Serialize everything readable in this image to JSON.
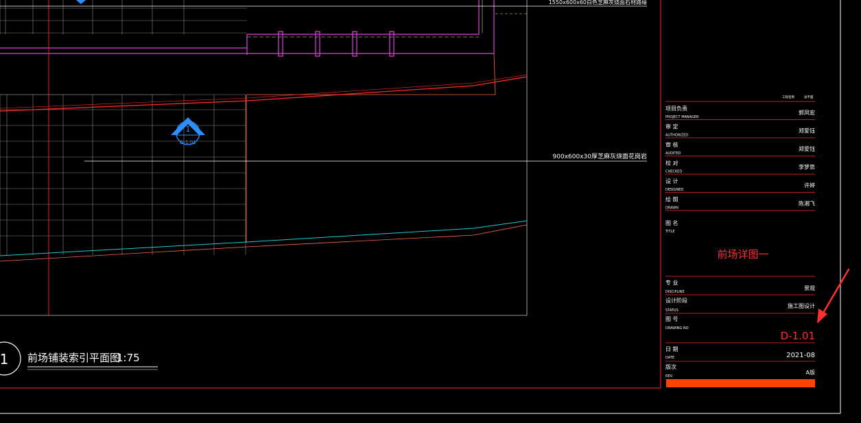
{
  "plan": {
    "top_note": "1550x600x60白色芝麻灰烧面石材路缘",
    "paving_note": "900x600x30厚芝麻灰烧面花岗岩",
    "index_symbol": {
      "number": "1",
      "sheet": "D-1.01"
    },
    "title_number": "1",
    "title_name": "前场铺装索引平面图",
    "scale": "1:75"
  },
  "title_block": {
    "header_left": "工程名称",
    "header_right": "总平面",
    "rows": [
      {
        "cn": "项目负责",
        "en": "PROJECT MANAGER",
        "value": "郭凤宏"
      },
      {
        "cn": "审 定",
        "en": "AUTHORIZED",
        "value": "郑爱钰"
      },
      {
        "cn": "审 核",
        "en": "AUDITED",
        "value": "郑爱钰"
      },
      {
        "cn": "校 对",
        "en": "CHECKED",
        "value": "李梦思"
      },
      {
        "cn": "设 计",
        "en": "DESIGNED",
        "value": "许婷"
      },
      {
        "cn": "绘 图",
        "en": "DRAWN",
        "value": "陈湘飞"
      }
    ],
    "title": {
      "cn": "图 名",
      "en": "TITLE",
      "value": "前场详图一"
    },
    "discipline": {
      "cn": "专 业",
      "en": "DISCIPLINE",
      "value": "景观"
    },
    "status": {
      "cn": "设计阶段",
      "en": "STATUS",
      "value": "施工图设计"
    },
    "drawing_no": {
      "cn": "图 号",
      "en": "DRAWING NO",
      "value": "D-1.01"
    },
    "date": {
      "cn": "日 期",
      "en": "DATE",
      "value": "2021-08"
    },
    "rev": {
      "cn": "版次",
      "en": "REV.",
      "value": "A版"
    }
  },
  "colors": {
    "background": "#000000",
    "frame_red": "#ff2a2a",
    "magenta": "#e040e0",
    "cyan": "#20d0d0",
    "blue": "#2e8fff",
    "grid_gray": "#8a8a8a",
    "salmon": "#ff6a50",
    "orange_bar": "#ff4400",
    "annotation_red": "#ff3030"
  }
}
